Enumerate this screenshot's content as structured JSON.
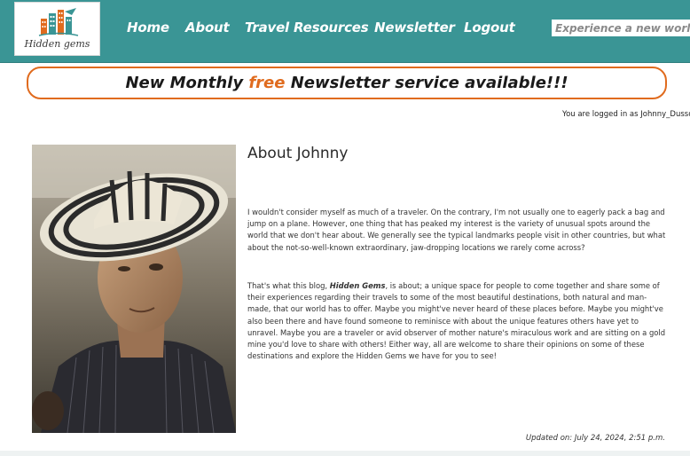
{
  "header": {
    "logo_text": "Hidden gems",
    "nav": [
      "Home",
      "About",
      "Travel Resources",
      "Newsletter",
      "Logout"
    ],
    "search_placeholder": "Experience a new world!"
  },
  "banner": {
    "before": "New Monthly ",
    "highlight": "free",
    "after": " Newsletter service available!!!"
  },
  "logged_in": "You are logged in as Johnny_Dusso",
  "about": {
    "title": "About Johnny",
    "paragraph1": "I wouldn't consider myself as much of a traveler.  On the contrary, I'm not usually one to eagerly pack a bag and jump on a plane.  However, one thing that has peaked my interest is the variety of unusual spots around the world that we don't hear about.  We generally see the typical landmarks people visit in other countries, but what about the not-so-well-known extraordinary, jaw-dropping locations we rarely come across?",
    "paragraph2_before": "That's what this blog, ",
    "paragraph2_emphasis": "Hidden Gems",
    "paragraph2_after": ", is about; a unique space for people to come together and share some of their experiences regarding their travels to some of the most beautiful destinations, both natural and man-made, that our world has to offer.  Maybe you might've never heard of these places before.  Maybe you might've also been there and have found someone to reminisce with about the unique features others have yet to unravel.  Maybe you are a traveler or avid observer of mother nature's miraculous work and are sitting on a gold mine you'd love to share with others! Either way, all are welcome to share their opinions on some of these destinations and explore the Hidden Gems we have for you to see!"
  },
  "updated": "Updated on: July 24, 2024, 2:51 p.m.",
  "colors": {
    "header_bg": "#3a9595",
    "accent_orange": "#e06b1e"
  }
}
